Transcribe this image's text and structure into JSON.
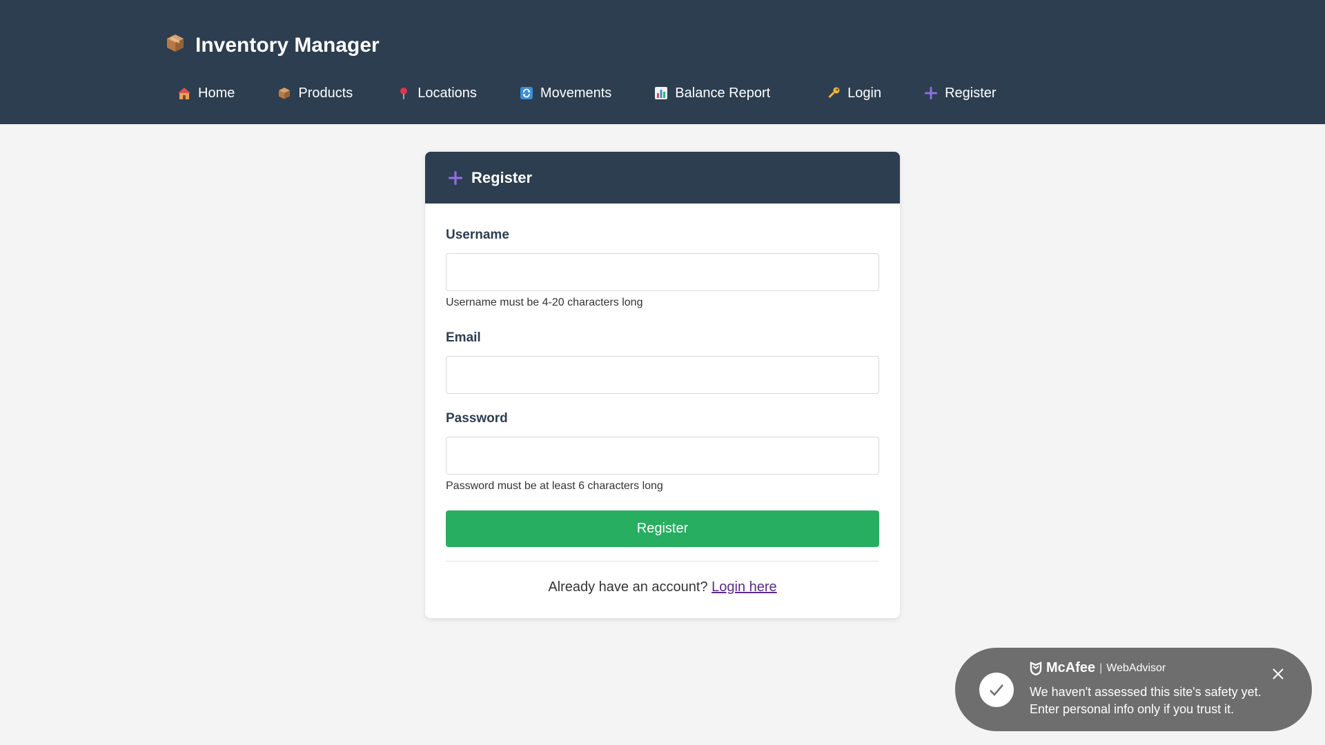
{
  "app": {
    "title": "Inventory Manager",
    "logo_icon": "package-icon"
  },
  "nav": {
    "items": [
      {
        "label": "Home",
        "icon": "house-icon"
      },
      {
        "label": "Products",
        "icon": "package-icon"
      },
      {
        "label": "Locations",
        "icon": "pin-icon"
      },
      {
        "label": "Movements",
        "icon": "refresh-icon"
      },
      {
        "label": "Balance Report",
        "icon": "bar-chart-icon"
      },
      {
        "label": "Login",
        "icon": "key-icon"
      },
      {
        "label": "Register",
        "icon": "plus-icon"
      }
    ]
  },
  "form": {
    "title": "Register",
    "title_icon": "plus-icon",
    "username_label": "Username",
    "username_value": "",
    "username_hint": "Username must be 4-20 characters long",
    "email_label": "Email",
    "email_value": "",
    "password_label": "Password",
    "password_value": "",
    "password_hint": "Password must be at least 6 characters long",
    "submit_label": "Register",
    "footer_text": "Already have an account?",
    "login_link": "Login here"
  },
  "toast": {
    "brand": "McAfee",
    "product": "WebAdvisor",
    "message": "We haven't assessed this site's safety yet. Enter personal info only if you trust it."
  },
  "colors": {
    "header_bg": "#2c3e50",
    "page_bg": "#f4f4f4",
    "button_green": "#27ae60",
    "link_purple": "#5b2a86",
    "plus_purple": "#8e6fe0",
    "toast_bg": "#6e6e6e"
  }
}
